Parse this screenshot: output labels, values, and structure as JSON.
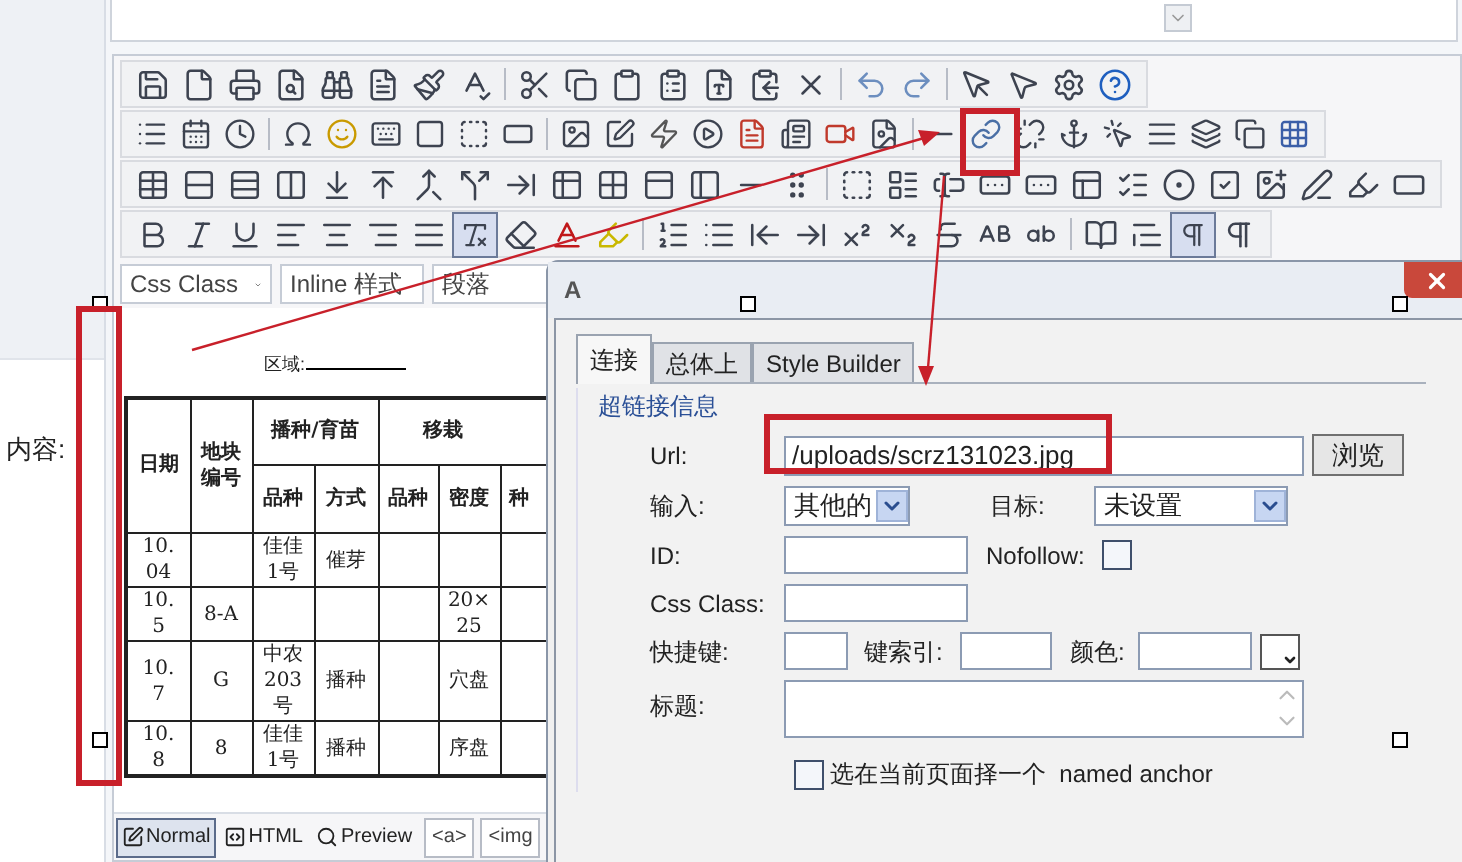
{
  "field_label": "内容:",
  "editor": {
    "dropdowns": [
      {
        "value": "Css Class"
      },
      {
        "value": "Inline 样式"
      },
      {
        "value": "段落"
      }
    ],
    "document": {
      "region_label": "区域:",
      "header_top": [
        "日期",
        "地块编号",
        "播种/育苗",
        "移栽"
      ],
      "header_sub": [
        "品种",
        "方式",
        "品种",
        "密度",
        "种"
      ],
      "rows": [
        [
          "10.\n04",
          "",
          "佳佳\n1号",
          "催芽",
          "",
          ""
        ],
        [
          "10.\n5",
          "8-A",
          "",
          "",
          "",
          "20×\n25"
        ],
        [
          "10.\n7",
          "G",
          "中农\n203\n号",
          "播种",
          "",
          "穴盘"
        ],
        [
          "10.\n8",
          "8",
          "佳佳\n1号",
          "播种",
          "",
          "序盘"
        ]
      ]
    },
    "modes": [
      {
        "label": "Normal",
        "selected": true
      },
      {
        "label": "HTML",
        "selected": false
      },
      {
        "label": "Preview",
        "selected": false
      }
    ],
    "tags": [
      "<a>",
      "<img"
    ]
  },
  "dialog": {
    "title": "A",
    "tabs": [
      {
        "label": "连接",
        "selected": true
      },
      {
        "label": "总体上",
        "selected": false
      },
      {
        "label": "Style Builder",
        "selected": false
      }
    ],
    "legend": "超链接信息",
    "url": {
      "label": "Url:",
      "value": "/uploads/scrz131023.jpg",
      "button": "浏览"
    },
    "type": {
      "label": "输入:",
      "value": "其他的"
    },
    "target": {
      "label": "目标:",
      "value": "未设置"
    },
    "id": {
      "label": "ID:"
    },
    "nofollow": {
      "label": "Nofollow:",
      "checked": false
    },
    "css_class": {
      "label": "Css Class:"
    },
    "access_key": {
      "label": "快捷键:"
    },
    "tab_index": {
      "label": "键索引:"
    },
    "color": {
      "label": "颜色:"
    },
    "title_field": {
      "label": "标题:"
    },
    "anchor": {
      "label": "选在当前页面择一个  named anchor",
      "checked": false
    }
  }
}
